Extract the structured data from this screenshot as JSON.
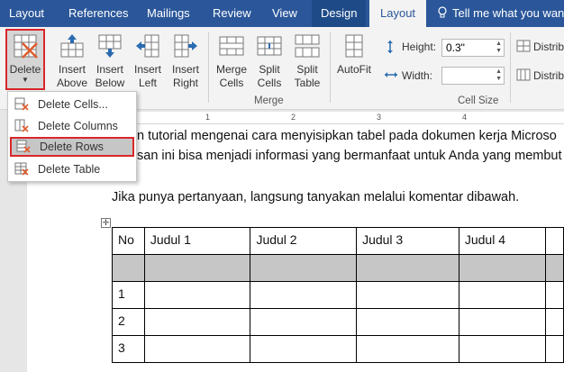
{
  "tabs": {
    "layout_left": "Layout",
    "references": "References",
    "mailings": "Mailings",
    "review": "Review",
    "view": "View",
    "design": "Design",
    "layout_active": "Layout",
    "tell_me": "Tell me what you want"
  },
  "ribbon": {
    "delete": "Delete",
    "insert_above": "Insert\nAbove",
    "insert_below": "Insert\nBelow",
    "insert_left": "Insert\nLeft",
    "insert_right": "Insert\nRight",
    "merge_cells": "Merge\nCells",
    "split_cells": "Split\nCells",
    "split_table": "Split\nTable",
    "autofit": "AutoFit",
    "group_rows_cols": "s",
    "group_merge": "Merge",
    "group_cell_size": "Cell Size",
    "height_label": "Height:",
    "height_value": "0.3\"",
    "width_label": "Width:",
    "width_value": "",
    "distribute": "Distrib"
  },
  "delete_menu": {
    "cells": "Delete Cells...",
    "columns": "Delete Columns",
    "rows": "Delete Rows",
    "table": "Delete Table"
  },
  "ruler": [
    "1",
    "2",
    "3",
    "4"
  ],
  "document": {
    "line1": "n tutorial mengenai cara menyisipkan tabel pada dokumen kerja Microso",
    "line2": "san ini bisa menjadi informasi yang bermanfaat untuk Anda yang membut",
    "line3": "Jika punya pertanyaan, langsung tanyakan melalui komentar dibawah."
  },
  "table": {
    "headers": [
      "No",
      "Judul 1",
      "Judul 2",
      "Judul 3",
      "Judul 4"
    ],
    "row_numbers": [
      "",
      "1",
      "2",
      "3"
    ]
  },
  "colors": {
    "tab_bar": "#2b579a",
    "highlight_outline": "#d9262a",
    "selected_row": "#c6c6c6"
  },
  "icons": [
    "bulb-icon",
    "delete-table-icon",
    "insert-above-icon",
    "insert-below-icon",
    "insert-left-icon",
    "insert-right-icon",
    "merge-cells-icon",
    "split-cells-icon",
    "split-table-icon",
    "autofit-icon",
    "height-icon",
    "width-icon",
    "distribute-icon",
    "table-move-handle-icon"
  ]
}
